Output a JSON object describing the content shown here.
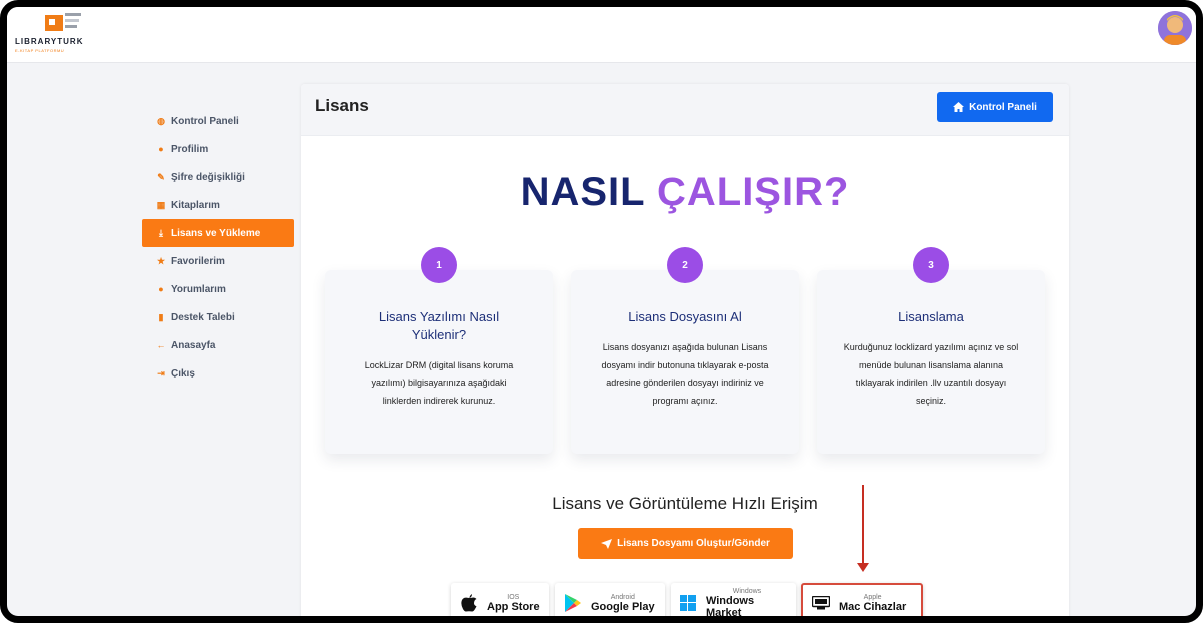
{
  "app": {
    "brand": "LIBRARYTURK",
    "brand_sub": "E-KITAP PLATFORMU"
  },
  "sidebar": {
    "items": [
      {
        "label": "Kontrol Paneli",
        "icon": "dashboard-icon",
        "glyph": "◍"
      },
      {
        "label": "Profilim",
        "icon": "user-icon",
        "glyph": "●"
      },
      {
        "label": "Şifre değişikliği",
        "icon": "key-icon",
        "glyph": "✎"
      },
      {
        "label": "Kitaplarım",
        "icon": "book-icon",
        "glyph": "▦"
      },
      {
        "label": "Lisans ve Yükleme",
        "icon": "download-icon",
        "glyph": "⤓",
        "active": true
      },
      {
        "label": "Favorilerim",
        "icon": "star-icon",
        "glyph": "★"
      },
      {
        "label": "Yorumlarım",
        "icon": "comment-icon",
        "glyph": "●"
      },
      {
        "label": "Destek Talebi",
        "icon": "bookmark-icon",
        "glyph": "▮"
      },
      {
        "label": "Anasayfa",
        "icon": "arrow-left-icon",
        "glyph": "←"
      },
      {
        "label": "Çıkış",
        "icon": "logout-icon",
        "glyph": "⇥"
      }
    ]
  },
  "panel": {
    "title": "Lisans",
    "dashboard_button": "Kontrol Paneli"
  },
  "hero": {
    "part1": "NASIL",
    "part2": "ÇALIŞIR?"
  },
  "steps": [
    {
      "num": "1",
      "title": "Lisans Yazılımı Nasıl Yüklenir?",
      "text": "LockLizar DRM (digital lisans koruma yazılımı) bilgisayarınıza aşağıdaki linklerden indirerek kurunuz."
    },
    {
      "num": "2",
      "title": "Lisans Dosyasını Al",
      "text": "Lisans dosyanızı aşağıda bulunan Lisans dosyamı indir butonuna tıklayarak e-posta adresine gönderilen dosyayı indiriniz ve programı açınız."
    },
    {
      "num": "3",
      "title": "Lisanslama",
      "text": "Kurduğunuz locklizard yazılımı açınız ve sol menüde bulunan lisanslama alanına tıklayarak indirilen .llv uzantılı dosyayı seçiniz."
    }
  ],
  "quick_access": {
    "title": "Lisans ve Görüntüleme Hızlı Erişim",
    "send_button": "Lisans Dosyamı Oluştur/Gönder"
  },
  "stores": [
    {
      "small": "IOS",
      "big": "App Store",
      "icon": "apple-icon"
    },
    {
      "small": "Android",
      "big": "Google Play",
      "icon": "google-play-icon"
    },
    {
      "small": "Windows",
      "big": "Windows Market",
      "icon": "windows-icon"
    },
    {
      "small": "Apple",
      "big": "Mac Cihazlar",
      "icon": "mac-icon"
    }
  ],
  "colors": {
    "accent_orange": "#fa7a14",
    "primary_blue": "#1169f0",
    "purple": "#9b4de6",
    "navy": "#17256e",
    "annotation_red": "#c62e22"
  }
}
